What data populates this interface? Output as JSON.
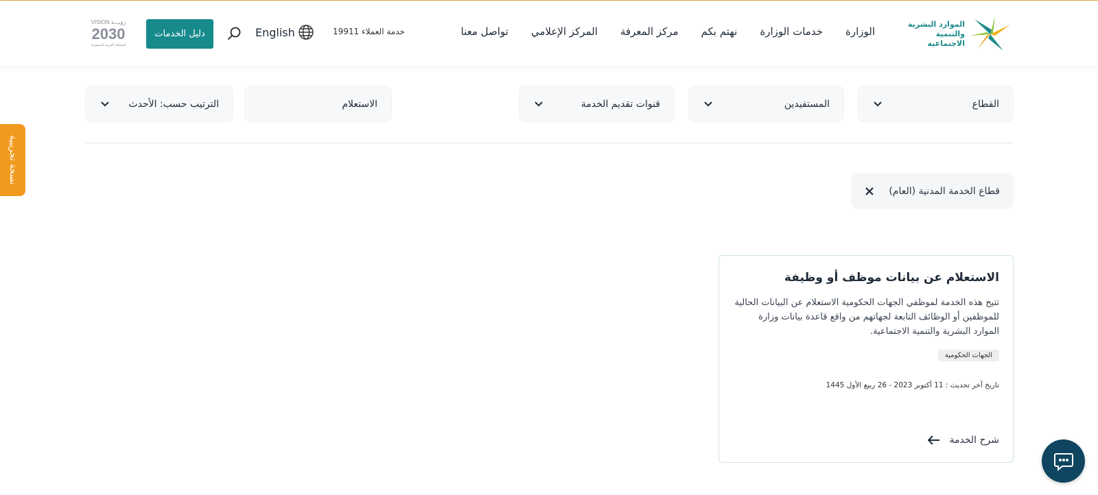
{
  "header": {
    "logo_line1": "الموارد البشرية",
    "logo_line2": "والتنمية الاجتماعية",
    "nav": [
      "الوزارة",
      "خدمات الوزارة",
      "نهتم بكم",
      "مركز المعرفة",
      "المركز الإعلامي",
      "تواصل معنا"
    ],
    "customer_service": "خدمة العملاء 19911",
    "language": "English",
    "services_guide": "دليل الخدمات",
    "vision_top": "VISION رؤيـــة",
    "vision_year": "2030",
    "vision_sub": "المملكة العربية السعودية"
  },
  "filters": {
    "sector": "القطاع",
    "beneficiaries": "المستفيدين",
    "channels": "قنوات تقديم الخدمة",
    "search_value": "الاستعلام",
    "sort": "الترتيب حسب: الأحدث"
  },
  "active_filter": "قطاع الخدمة المدنية (العام)",
  "card": {
    "title": "الاستعلام عن بيانات موظف أو وظيفة",
    "description": "تتيح هذه الخدمة لموظفي الجهات الحكومية الاستعلام عن البيانات الحالية للموظفين أو الوظائف التابعة لجهاتهم من واقع قاعدة بيانات وزارة الموارد البشرية والتنمية الاجتماعية.",
    "tag": "الجهات الحكومية",
    "updated": "تاريخ آخر تحديث : 11 أكتوبر 2023 - 26 ربيع الأول 1445",
    "explain": "شرح الخدمة"
  },
  "side_tab": "نسخة تجريبية",
  "colors": {
    "teal": "#178a8c",
    "orange": "#f29a1e",
    "navy": "#0f4560"
  }
}
